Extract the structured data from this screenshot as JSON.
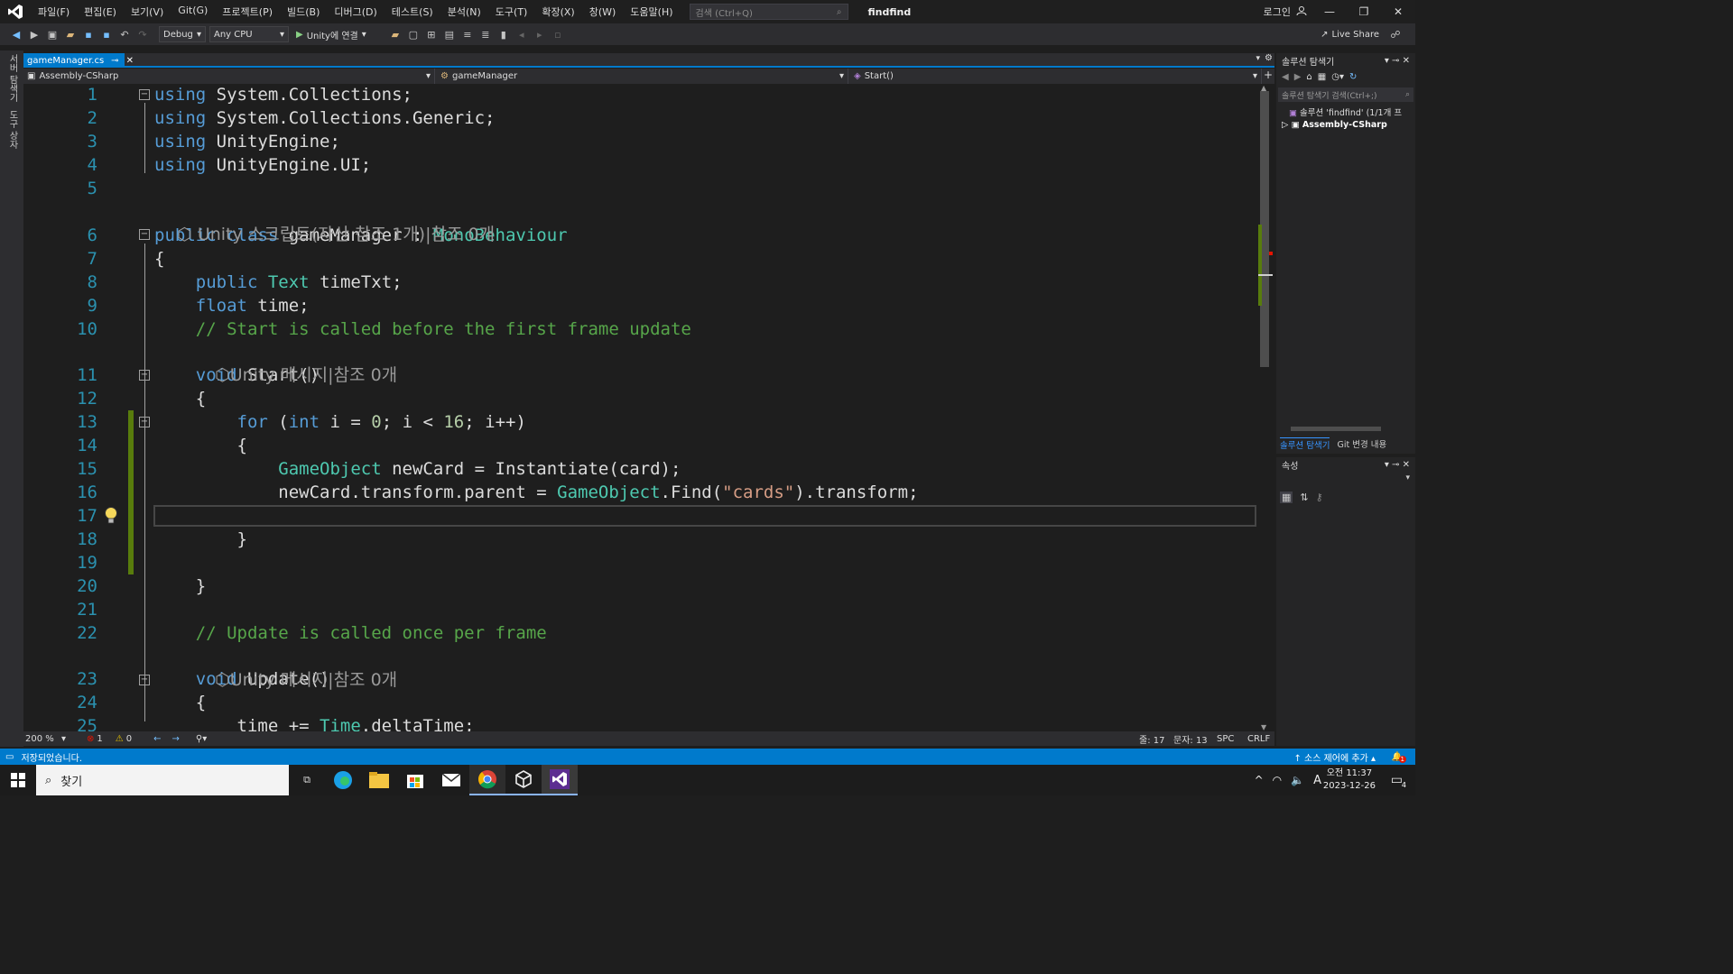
{
  "menubar": {
    "items": [
      "파일(F)",
      "편집(E)",
      "보기(V)",
      "Git(G)",
      "프로젝트(P)",
      "빌드(B)",
      "디버그(D)",
      "테스트(S)",
      "분석(N)",
      "도구(T)",
      "확장(X)",
      "창(W)",
      "도움말(H)"
    ],
    "search_placeholder": "검색 (Ctrl+Q)",
    "solution_name": "findfind",
    "login": "로그인"
  },
  "toolbar": {
    "config": "Debug",
    "platform": "Any CPU",
    "run_label": "Unity에 연결",
    "live_share": "Live Share"
  },
  "left_strip": {
    "tab1": "서버 탐색기",
    "tab2": "도구 상자"
  },
  "editor": {
    "tab_name": "gameManager.cs",
    "nav_project": "Assembly-CSharp",
    "nav_class": "gameManager",
    "nav_member": "Start()",
    "lines": [
      {
        "n": "1",
        "tokens": [
          [
            "kw",
            "using"
          ],
          [
            "",
            " System.Collections;"
          ]
        ]
      },
      {
        "n": "2",
        "tokens": [
          [
            "kw",
            "using"
          ],
          [
            "",
            " System.Collections.Generic;"
          ]
        ]
      },
      {
        "n": "3",
        "tokens": [
          [
            "kw",
            "using"
          ],
          [
            "",
            " UnityEngine;"
          ]
        ]
      },
      {
        "n": "4",
        "tokens": [
          [
            "kw",
            "using"
          ],
          [
            "",
            " UnityEngine.UI;"
          ]
        ]
      },
      {
        "n": "5",
        "tokens": []
      },
      {
        "n": "6",
        "tokens": [
          [
            "kw",
            "public class"
          ],
          [
            "",
            " gameManager : "
          ],
          [
            "ty",
            "MonoBehaviour"
          ]
        ]
      },
      {
        "n": "7",
        "tokens": [
          [
            "",
            "{"
          ]
        ]
      },
      {
        "n": "8",
        "tokens": [
          [
            "",
            "    "
          ],
          [
            "kw",
            "public"
          ],
          [
            "",
            " "
          ],
          [
            "ty",
            "Text"
          ],
          [
            "",
            " timeTxt;"
          ]
        ]
      },
      {
        "n": "9",
        "tokens": [
          [
            "",
            "    "
          ],
          [
            "kw",
            "float"
          ],
          [
            "",
            " time;"
          ]
        ]
      },
      {
        "n": "10",
        "tokens": [
          [
            "",
            "    "
          ],
          [
            "cm",
            "// Start is called before the first frame update"
          ]
        ]
      },
      {
        "n": "11",
        "tokens": [
          [
            "",
            "    "
          ],
          [
            "kw",
            "void"
          ],
          [
            "",
            " Start()"
          ]
        ]
      },
      {
        "n": "12",
        "tokens": [
          [
            "",
            "    {"
          ]
        ]
      },
      {
        "n": "13",
        "tokens": [
          [
            "",
            "        "
          ],
          [
            "kw",
            "for"
          ],
          [
            "",
            " ("
          ],
          [
            "kw",
            "int"
          ],
          [
            "",
            " i = "
          ],
          [
            "nm",
            "0"
          ],
          [
            "",
            "; i < "
          ],
          [
            "nm",
            "16"
          ],
          [
            "",
            "; i++)"
          ]
        ]
      },
      {
        "n": "14",
        "tokens": [
          [
            "",
            "        {"
          ]
        ]
      },
      {
        "n": "15",
        "tokens": [
          [
            "",
            "            "
          ],
          [
            "ty",
            "GameObject"
          ],
          [
            "",
            " newCard = Instantiate(card);"
          ]
        ]
      },
      {
        "n": "16",
        "tokens": [
          [
            "",
            "            newCard.transform.parent = "
          ],
          [
            "ty",
            "GameObject"
          ],
          [
            "",
            ".Find("
          ],
          [
            "st",
            "\"cards\""
          ],
          [
            "",
            ").transform;"
          ]
        ]
      },
      {
        "n": "17",
        "tokens": []
      },
      {
        "n": "18",
        "tokens": [
          [
            "",
            "        }"
          ]
        ]
      },
      {
        "n": "19",
        "tokens": []
      },
      {
        "n": "20",
        "tokens": [
          [
            "",
            "    }"
          ]
        ]
      },
      {
        "n": "21",
        "tokens": []
      },
      {
        "n": "22",
        "tokens": [
          [
            "",
            "    "
          ],
          [
            "cm",
            "// Update is called once per frame"
          ]
        ]
      },
      {
        "n": "23",
        "tokens": [
          [
            "",
            "    "
          ],
          [
            "kw",
            "void"
          ],
          [
            "",
            " Update()"
          ]
        ]
      },
      {
        "n": "24",
        "tokens": [
          [
            "",
            "    {"
          ]
        ]
      },
      {
        "n": "25",
        "tokens": [
          [
            "",
            "        time += "
          ],
          [
            "ty",
            "Time"
          ],
          [
            "",
            ".deltaTime;"
          ]
        ]
      }
    ],
    "codelens_class": "Unity 스크립트(자산 참조 1개)|참조 0개",
    "codelens_start": "Unity 메시지|참조 0개",
    "codelens_update": "Unity 메시지|참조 0개"
  },
  "edstatus": {
    "zoom": "200 %",
    "errors": "1",
    "warnings": "0",
    "line": "줄: 17",
    "col": "문자: 13",
    "spc": "SPC",
    "eol": "CRLF"
  },
  "solution_explorer": {
    "title": "솔루션 탐색기",
    "search_placeholder": "솔루션 탐색기 검색(Ctrl+;)",
    "solution_item": "솔루션 'findfind' (1/1개 프",
    "project_item": "Assembly-CSharp",
    "tab1": "솔루션 탐색기",
    "tab2": "Git 변경 내용"
  },
  "properties": {
    "title": "속성"
  },
  "statusbar": {
    "message": "저장되었습니다.",
    "source_control": "소스 제어에 추가",
    "notif_count": "1"
  },
  "taskbar": {
    "search": "찾기",
    "time": "오전 11:37",
    "date": "2023-12-26",
    "ime": "A",
    "notif_count": "4"
  },
  "colors": {
    "accent": "#007acc",
    "keyword": "#569cd6",
    "type": "#4ec9b0",
    "comment": "#57a64a",
    "string": "#d69d85"
  }
}
